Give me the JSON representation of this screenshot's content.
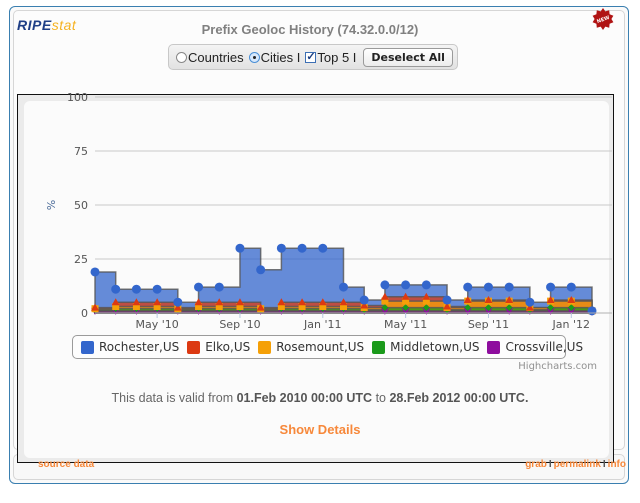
{
  "logo": {
    "ripe": "RIPE",
    "stat": "stat"
  },
  "badge": {
    "label": "NEW",
    "color": "#b01414"
  },
  "title": "Prefix Geoloc History (74.32.0.0/12)",
  "controls": {
    "countries_label": "Countries",
    "countries_selected": false,
    "cities_label": "Cities I",
    "cities_selected": true,
    "top5_label": "Top 5 I",
    "top5_checked": true,
    "checkmark": "✓",
    "deselect_label": "Deselect All"
  },
  "chart_data": {
    "type": "area",
    "stacked": true,
    "step": true,
    "title": "",
    "xlabel": "",
    "ylabel": "%",
    "ylim": [
      0,
      100
    ],
    "yticks": [
      "0",
      "25",
      "50",
      "75",
      "100"
    ],
    "xticks": [
      "May '10",
      "Sep '10",
      "Jan '11",
      "May '11",
      "Sep '11",
      "Jan '12"
    ],
    "xtick_months": [
      3,
      7,
      11,
      15,
      19,
      23
    ],
    "grid": true,
    "legend_position": "bottom-center",
    "x": [
      "Feb 2010",
      "Mar 2010",
      "Apr 2010",
      "May 2010",
      "Jun 2010",
      "Jul 2010",
      "Aug 2010",
      "Sep 2010",
      "Oct 2010",
      "Nov 2010",
      "Dec 2010",
      "Jan 2011",
      "Feb 2011",
      "Mar 2011",
      "Apr 2011",
      "May 2011",
      "Jun 2011",
      "Jul 2011",
      "Aug 2011",
      "Sep 2011",
      "Oct 2011",
      "Nov 2011",
      "Dec 2011",
      "Jan 2012",
      "Feb 2012"
    ],
    "series": [
      {
        "name": "Crossville,US",
        "color": "#8e0d9e",
        "marker": "triangle-down",
        "values": [
          1,
          1,
          1,
          1,
          1,
          1,
          1,
          1,
          1,
          1,
          1,
          1,
          1,
          1,
          1,
          1,
          1,
          1,
          1,
          1,
          1,
          1,
          1,
          1,
          0.5
        ]
      },
      {
        "name": "Middletown,US",
        "color": "#1b9a1b",
        "marker": "diamond",
        "values": [
          0.5,
          1,
          1,
          1,
          0.5,
          1,
          1,
          1,
          0.5,
          1,
          1,
          1,
          1,
          0.5,
          1.5,
          1.5,
          1.5,
          0.5,
          1.5,
          1.5,
          1.5,
          0.5,
          1.5,
          1.5,
          0.5
        ]
      },
      {
        "name": "Rosemount,US",
        "color": "#f5a007",
        "marker": "square",
        "values": [
          0.5,
          1,
          1,
          1,
          0.5,
          1,
          1,
          1,
          0.5,
          1,
          1,
          1,
          1,
          1,
          3,
          3,
          3,
          1,
          3,
          3,
          3,
          1,
          3,
          3,
          0
        ]
      },
      {
        "name": "Elko,US",
        "color": "#dc3912",
        "marker": "triangle",
        "values": [
          0.5,
          2,
          2,
          2,
          0.5,
          2,
          2,
          2,
          0.5,
          2,
          2,
          2,
          2,
          1,
          2,
          2,
          2,
          0.5,
          0.5,
          0.5,
          0.5,
          0,
          0.5,
          0.5,
          0
        ]
      },
      {
        "name": "Rochester,US",
        "color": "#3366cc",
        "marker": "circle",
        "values": [
          16.5,
          6,
          6,
          6,
          2.5,
          7,
          7,
          25,
          17.5,
          25,
          25,
          25,
          7,
          2.5,
          5.5,
          5.5,
          5.5,
          3,
          6,
          6,
          6,
          2.5,
          6,
          6,
          0
        ]
      }
    ]
  },
  "legend": [
    {
      "label": "Rochester,US",
      "color": "#3366cc"
    },
    {
      "label": "Elko,US",
      "color": "#dc3912"
    },
    {
      "label": "Rosemount,US",
      "color": "#f5a007"
    },
    {
      "label": "Middletown,US",
      "color": "#1b9a1b"
    },
    {
      "label": "Crossville,US",
      "color": "#8e0d9e"
    }
  ],
  "credits": "Highcharts.com",
  "validity": {
    "prefix": "This data is valid from ",
    "from": "01.Feb 2010 00:00 UTC",
    "middle": " to ",
    "to": "28.Feb 2012 00:00 UTC."
  },
  "show_details": "Show Details",
  "footer": {
    "source_data": "source data",
    "grab": "grab",
    "permalink": "permalink",
    "info": "info",
    "separator": "I"
  }
}
